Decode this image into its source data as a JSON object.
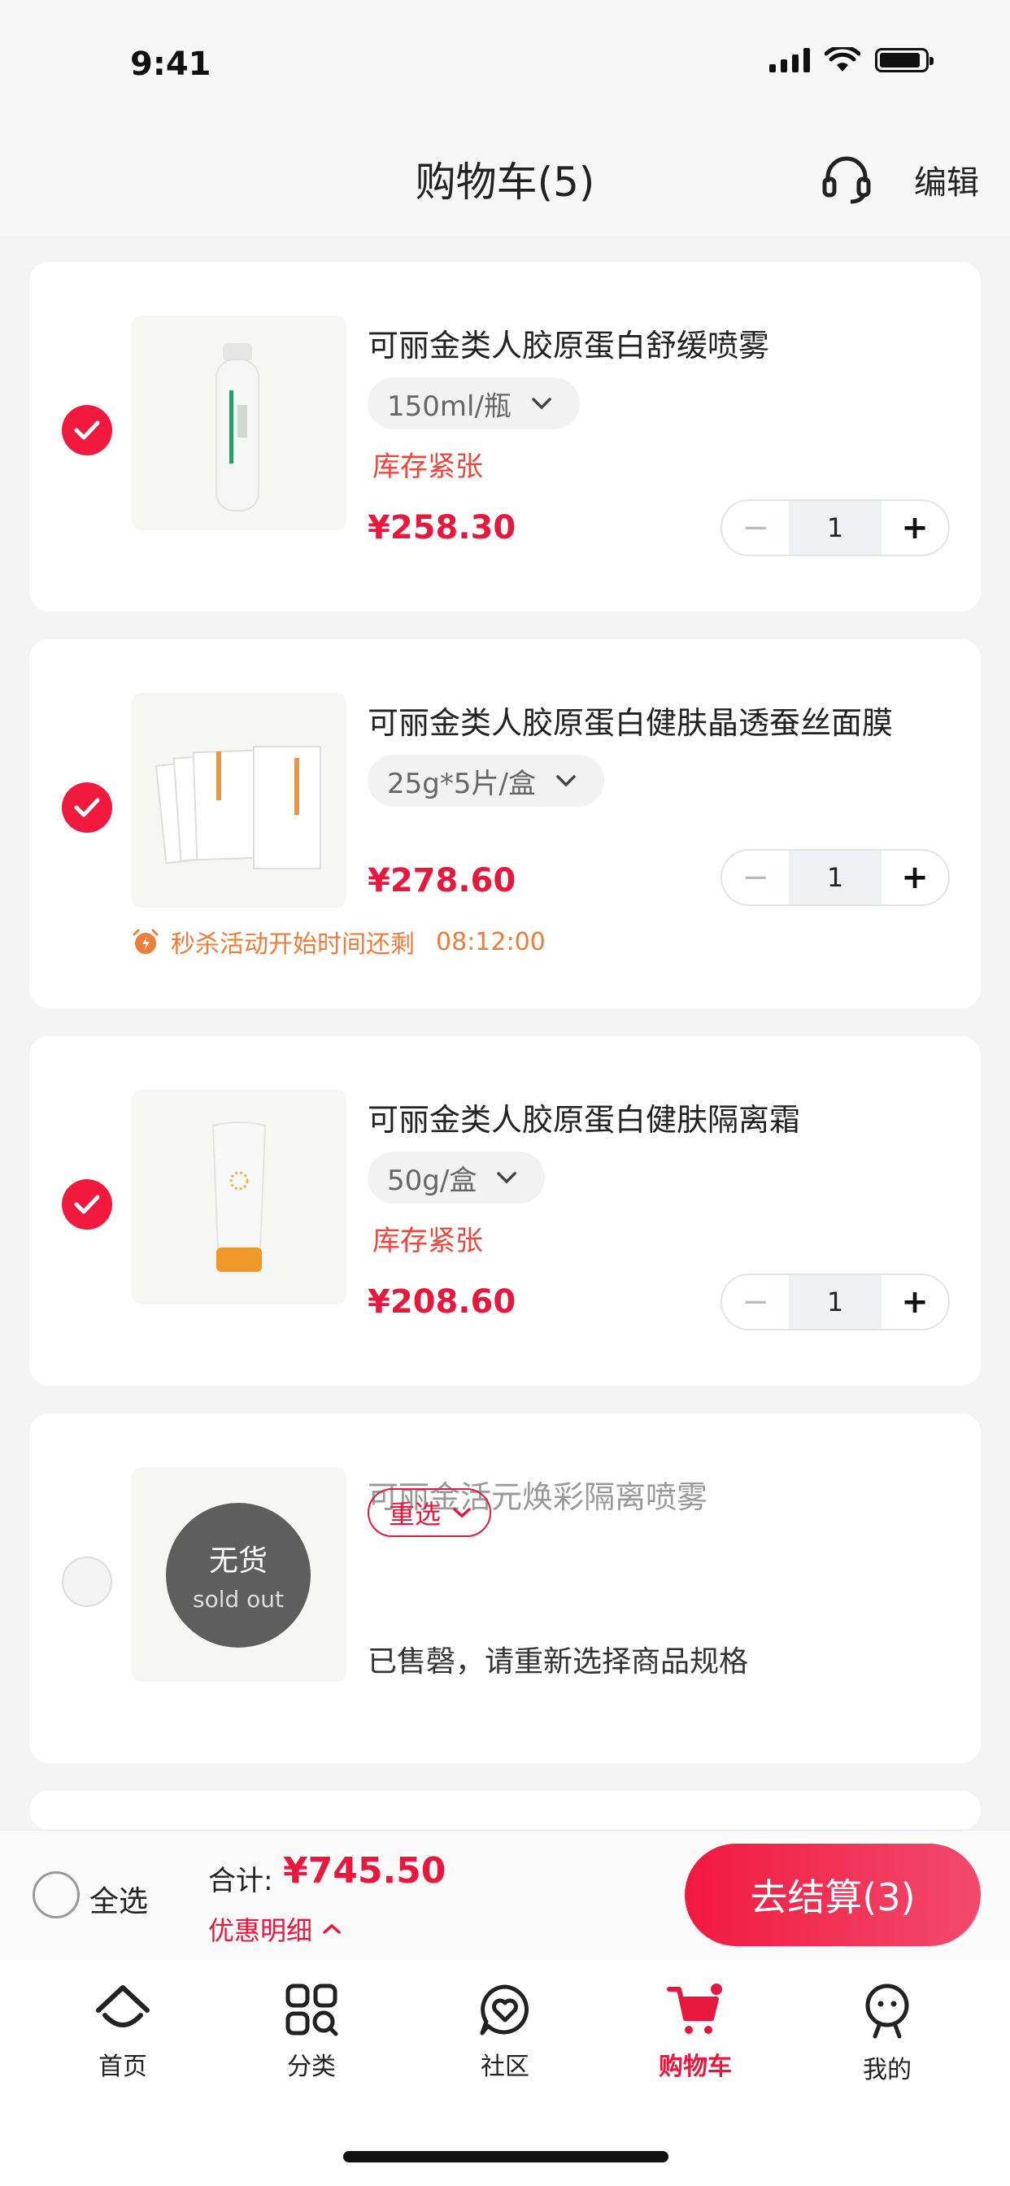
{
  "status_bar": {
    "time": "9:41"
  },
  "header": {
    "title": "购物车(5)",
    "edit_label": "编辑",
    "support_icon": "headset-icon"
  },
  "items": [
    {
      "name": "可丽金类人胶原蛋白舒缓喷雾",
      "spec": "150ml/瓶",
      "stock_tag": "库存紧张",
      "price": "¥258.30",
      "quantity": "1",
      "minus": "−",
      "plus": "+",
      "checked": true
    },
    {
      "name": "可丽金类人胶原蛋白健肤晶透蚕丝面膜",
      "spec": "25g*5片/盒",
      "price": "¥278.60",
      "quantity": "1",
      "minus": "−",
      "plus": "+",
      "flash_sale_text": "秒杀活动开始时间还剩",
      "flash_sale_timer": "08:12:00",
      "checked": true
    },
    {
      "name": "可丽金类人胶原蛋白健肤隔离霜",
      "spec": "50g/盒",
      "stock_tag": "库存紧张",
      "price": "¥208.60",
      "quantity": "1",
      "minus": "−",
      "plus": "+",
      "checked": true
    },
    {
      "name": "可丽金活元焕彩隔离喷雾",
      "sold_out_zh": "无货",
      "sold_out_en": "sold out",
      "reselect_label": "重选",
      "message": "已售磬，请重新选择商品规格",
      "checked": false
    }
  ],
  "checkout": {
    "select_all_label": "全选",
    "total_label": "合计:",
    "total_value": "¥745.50",
    "discount_label": "优惠明细",
    "button_label": "去结算(3)"
  },
  "tabs": [
    {
      "label": "首页",
      "icon": "home-icon"
    },
    {
      "label": "分类",
      "icon": "category-icon"
    },
    {
      "label": "社区",
      "icon": "community-icon"
    },
    {
      "label": "购物车",
      "icon": "cart-icon",
      "active": true
    },
    {
      "label": "我的",
      "icon": "profile-icon"
    }
  ],
  "colors": {
    "accent": "#e8173b",
    "stock_tag": "#f0453a",
    "flash_sale": "#f07c3a",
    "background": "#f4f4f4"
  }
}
